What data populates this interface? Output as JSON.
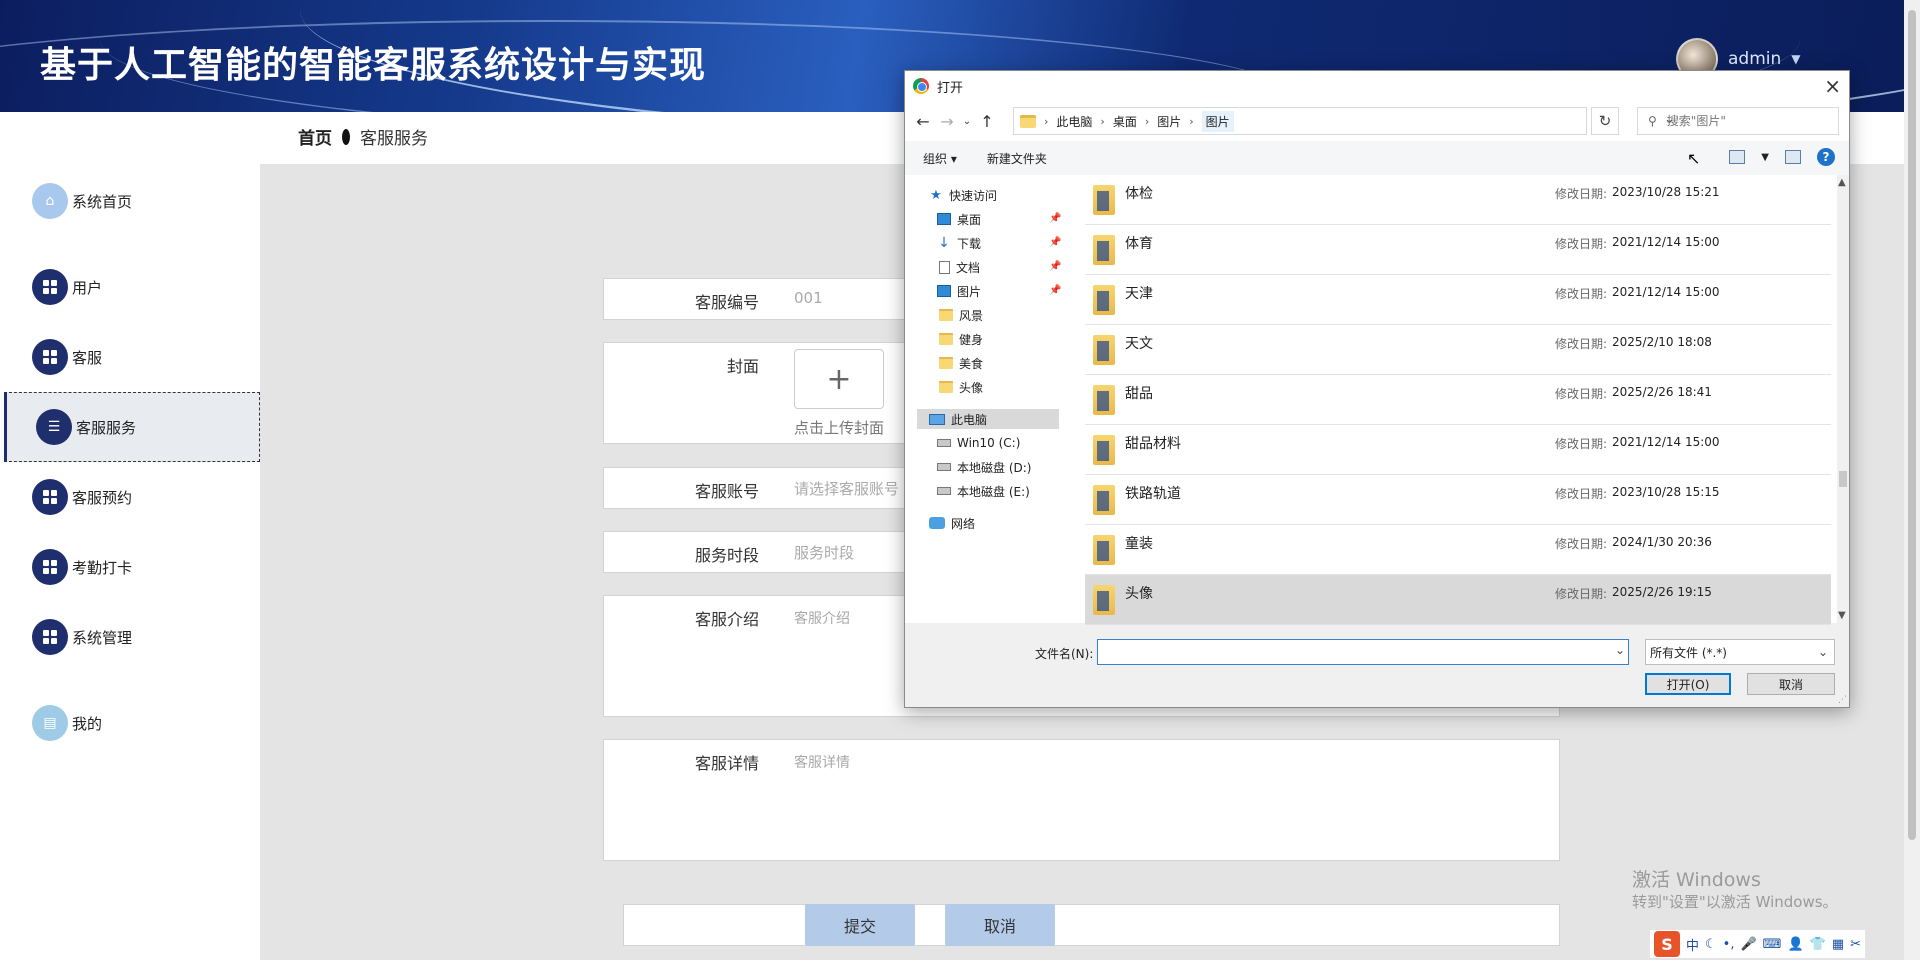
{
  "header": {
    "title": "基于人工智能的智能客服系统设计与实现",
    "user_name": "admin",
    "caret": "▼"
  },
  "sidebar": {
    "items": [
      {
        "label": "系统首页",
        "icon": "home-icon"
      },
      {
        "label": "用户",
        "icon": "grid-icon"
      },
      {
        "label": "客服",
        "icon": "grid-icon"
      },
      {
        "label": "客服服务",
        "icon": "sliders-icon",
        "active": true
      },
      {
        "label": "客服预约",
        "icon": "grid-icon"
      },
      {
        "label": "考勤打卡",
        "icon": "grid-icon"
      },
      {
        "label": "系统管理",
        "icon": "grid-icon"
      },
      {
        "label": "我的",
        "icon": "wallet-icon"
      }
    ]
  },
  "breadcrumb": {
    "home": "首页",
    "current": "客服服务"
  },
  "form": {
    "service_no": {
      "label": "客服编号",
      "value": "001"
    },
    "cover": {
      "label": "封面",
      "upload_plus": "+",
      "hint": "点击上传封面"
    },
    "account": {
      "label": "客服账号",
      "placeholder": "请选择客服账号"
    },
    "time_slot": {
      "label": "服务时段",
      "placeholder": "服务时段"
    },
    "intro": {
      "label": "客服介绍",
      "placeholder": "客服介绍"
    },
    "detail": {
      "label": "客服详情",
      "placeholder": "客服详情"
    },
    "submit_label": "提交",
    "cancel_label": "取消"
  },
  "watermark": {
    "line1": "激活 Windows",
    "line2": "转到\"设置\"以激活 Windows。"
  },
  "tray": {
    "logo": "S",
    "ime": "中"
  },
  "dialog": {
    "title": "打开",
    "close": "×",
    "address": [
      "此电脑",
      "桌面",
      "图片",
      "图片"
    ],
    "search_placeholder": "搜索\"图片\"",
    "toolbar": {
      "organize": "组织 ▾",
      "new_folder": "新建文件夹",
      "help": "?"
    },
    "tree": [
      {
        "label": "快速访问",
        "type": "star"
      },
      {
        "label": "桌面",
        "type": "desktop",
        "pinned": true
      },
      {
        "label": "下载",
        "type": "down",
        "pinned": true
      },
      {
        "label": "文档",
        "type": "doc",
        "pinned": true
      },
      {
        "label": "图片",
        "type": "desktop",
        "pinned": true
      },
      {
        "label": "风景",
        "type": "folder"
      },
      {
        "label": "健身",
        "type": "folder"
      },
      {
        "label": "美食",
        "type": "folder"
      },
      {
        "label": "头像",
        "type": "folder"
      },
      {
        "label": "此电脑",
        "type": "pc",
        "selected": true
      },
      {
        "label": "Win10 (C:)",
        "type": "drive"
      },
      {
        "label": "本地磁盘 (D:)",
        "type": "drive"
      },
      {
        "label": "本地磁盘 (E:)",
        "type": "drive"
      },
      {
        "label": "网络",
        "type": "net"
      }
    ],
    "date_label": "修改日期:",
    "files": [
      {
        "name": "体检",
        "date": "2023/10/28 15:21"
      },
      {
        "name": "体育",
        "date": "2021/12/14 15:00"
      },
      {
        "name": "天津",
        "date": "2021/12/14 15:00"
      },
      {
        "name": "天文",
        "date": "2025/2/10 18:08"
      },
      {
        "name": "甜品",
        "date": "2025/2/26 18:41"
      },
      {
        "name": "甜品材料",
        "date": "2021/12/14 15:00"
      },
      {
        "name": "铁路轨道",
        "date": "2023/10/28 15:15"
      },
      {
        "name": "童装",
        "date": "2024/1/30 20:36"
      },
      {
        "name": "头像",
        "date": "2025/2/26 19:15",
        "selected": true
      }
    ],
    "filename_label": "文件名(N):",
    "filename_value": "",
    "filetype": "所有文件 (*.*)",
    "open_label": "打开(O)",
    "cancel_label": "取消"
  }
}
